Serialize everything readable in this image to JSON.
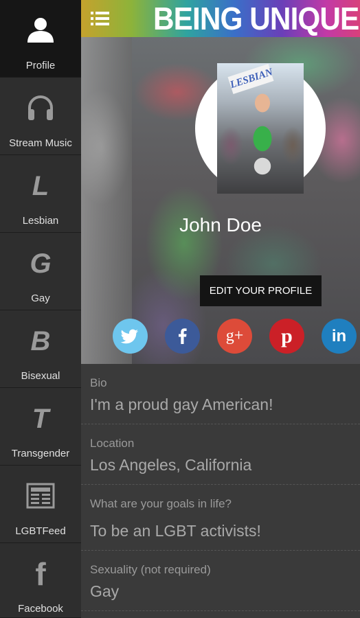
{
  "sidebar": {
    "items": [
      {
        "label": "Profile",
        "icon": "person-icon",
        "active": true
      },
      {
        "label": "Stream Music",
        "icon": "headphones-icon"
      },
      {
        "label": "Lesbian",
        "glyph": "L"
      },
      {
        "label": "Gay",
        "glyph": "G"
      },
      {
        "label": "Bisexual",
        "glyph": "B"
      },
      {
        "label": "Transgender",
        "glyph": "T"
      },
      {
        "label": "LGBTFeed",
        "icon": "newspaper-icon"
      },
      {
        "label": "Facebook",
        "glyph": "f"
      }
    ]
  },
  "header": {
    "brand": "BEING UNIQUE",
    "menu_icon": "menu-list-icon"
  },
  "profile": {
    "name": "John Doe",
    "edit_button": "EDIT YOUR PROFILE",
    "avatar_sign_text": "LESBIAN"
  },
  "social": [
    {
      "name": "twitter",
      "icon": "twitter-icon",
      "color": "#6ec6ee"
    },
    {
      "name": "facebook",
      "icon": "facebook-icon",
      "color": "#3c5a99"
    },
    {
      "name": "google-plus",
      "icon": "google-plus-icon",
      "glyph": "g+",
      "color": "#dd4b39"
    },
    {
      "name": "pinterest",
      "icon": "pinterest-icon",
      "glyph": "p",
      "color": "#cb2027"
    },
    {
      "name": "linkedin",
      "icon": "linkedin-icon",
      "glyph": "in",
      "color": "#1f7fbf"
    }
  ],
  "fields": [
    {
      "label": "Bio",
      "value": "I'm a proud gay American!"
    },
    {
      "label": "Location",
      "value": "Los Angeles, California"
    },
    {
      "label": "What are your goals in life?",
      "value": "To be an LGBT activists!"
    },
    {
      "label": "Sexuality (not required)",
      "value": "Gay"
    }
  ]
}
